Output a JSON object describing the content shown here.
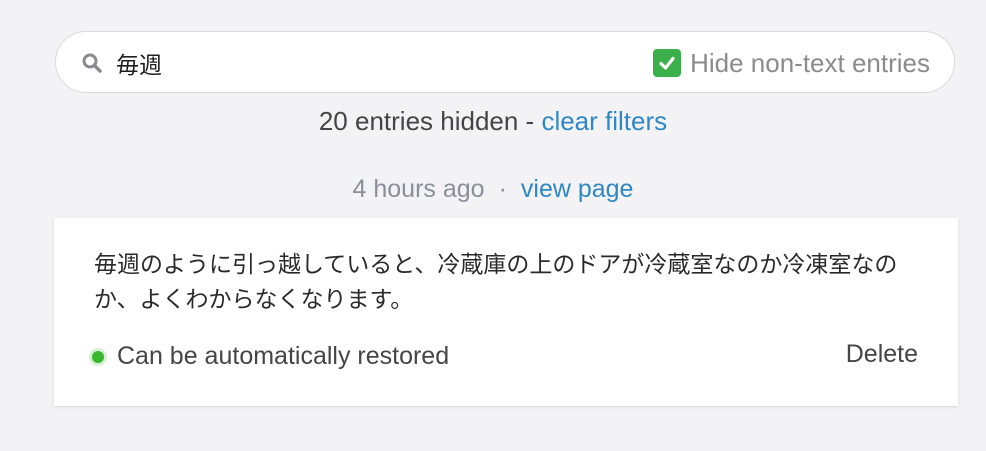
{
  "search": {
    "value": "毎週",
    "icon": "search-icon",
    "filter_label": "Hide non-text entries",
    "filter_checked": true,
    "checkbox_color": "#3bb04a"
  },
  "filters": {
    "hidden_text": "20 entries hidden - ",
    "clear_label": "clear filters"
  },
  "entry": {
    "time": "4 hours ago",
    "separator": "·",
    "view_label": "view page",
    "text": "毎週のように引っ越していると、冷蔵庫の上のドアが冷蔵室なのか冷凍室なのか、よくわからなくなります。",
    "status": "Can be automatically restored",
    "status_color": "#38b72f",
    "delete_label": "Delete"
  },
  "colors": {
    "link": "#2f87c4",
    "background": "#f3f3f5"
  }
}
